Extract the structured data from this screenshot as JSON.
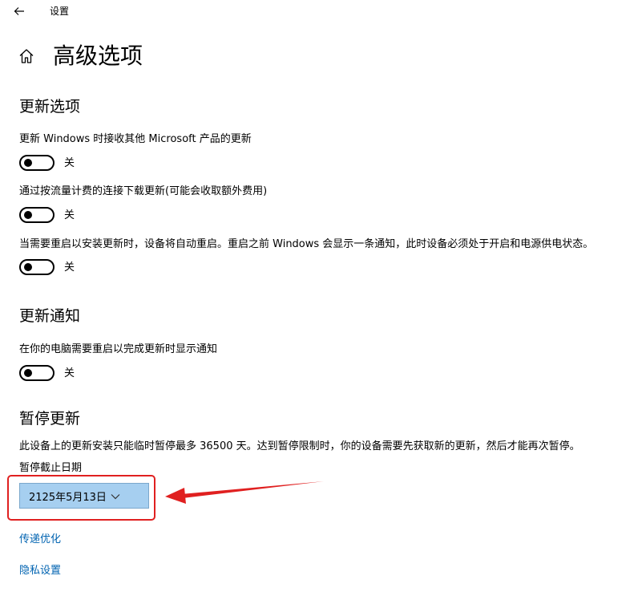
{
  "window": {
    "title": "设置",
    "back_icon": "back-arrow-icon"
  },
  "page": {
    "title": "高级选项",
    "home_icon": "home-icon"
  },
  "update_options": {
    "heading": "更新选项",
    "items": [
      {
        "label": "更新 Windows 时接收其他 Microsoft 产品的更新",
        "state": "关",
        "on": false
      },
      {
        "label": "通过按流量计费的连接下载更新(可能会收取额外费用)",
        "state": "关",
        "on": false
      },
      {
        "label": "当需要重启以安装更新时，设备将自动重启。重启之前 Windows 会显示一条通知，此时设备必须处于开启和电源供电状态。",
        "state": "关",
        "on": false
      }
    ]
  },
  "update_notifications": {
    "heading": "更新通知",
    "items": [
      {
        "label": "在你的电脑需要重启以完成更新时显示通知",
        "state": "关",
        "on": false
      }
    ]
  },
  "pause_updates": {
    "heading": "暂停更新",
    "description": "此设备上的更新安装只能临时暂停最多 36500 天。达到暂停限制时，你的设备需要先获取新的更新，然后才能再次暂停。",
    "date_label": "暂停截止日期",
    "date_value": "2125年5月13日",
    "dropdown_icon": "chevron-down-icon"
  },
  "links": {
    "delivery_optimization": "传递优化",
    "privacy_settings": "隐私设置"
  },
  "colors": {
    "link": "#0063b1",
    "dropdown_bg": "#a6cff0",
    "annotation": "#e02020"
  }
}
